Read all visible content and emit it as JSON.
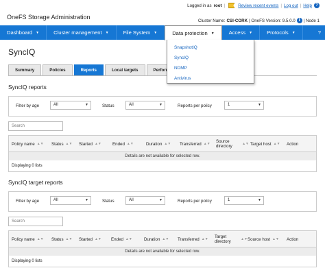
{
  "header": {
    "app_title": "OneFS Storage Administration",
    "logged_in_prefix": "Logged in as",
    "user": "root",
    "review_events": "Review recent events",
    "logout": "Log out",
    "help": "Help",
    "cluster_name_label": "Cluster Name:",
    "cluster_name": "CSI-CORK",
    "version_text": "| OneFS Version: 9.5.0.0",
    "node_text": "| Node 1"
  },
  "nav": {
    "items": [
      {
        "label": "Dashboard"
      },
      {
        "label": "Cluster management"
      },
      {
        "label": "File System"
      },
      {
        "label": "Data protection"
      },
      {
        "label": "Access"
      },
      {
        "label": "Protocols"
      }
    ],
    "help_label": "?"
  },
  "dropdown": {
    "items": [
      "SnapshotIQ",
      "SyncIQ",
      "NDMP",
      "Antivirus"
    ]
  },
  "page": {
    "title": "SyncIQ",
    "tabs": [
      "Summary",
      "Policies",
      "Reports",
      "Local targets",
      "Performance rules"
    ],
    "active_tab": "Reports"
  },
  "reports": {
    "title": "SyncIQ reports",
    "filter_by_age_label": "Filter by age",
    "filter_by_age_value": "All",
    "status_label": "Status",
    "status_value": "All",
    "reports_per_policy_label": "Reports per policy",
    "reports_per_policy_value": "1",
    "search_placeholder": "Search",
    "columns": [
      "Policy name",
      "Status",
      "Started",
      "Ended",
      "Duration",
      "Transferred",
      "Source directory",
      "Target host",
      "Action"
    ],
    "empty_message": "Details are not available for selected row.",
    "footer": "Displaying 0 lists"
  },
  "target_reports": {
    "title": "SyncIQ target reports",
    "filter_by_age_label": "Filter by age",
    "filter_by_age_value": "All",
    "status_label": "Status",
    "status_value": "All",
    "reports_per_policy_label": "Reports per policy",
    "reports_per_policy_value": "1",
    "search_placeholder": "Search",
    "columns": [
      "Policy name",
      "Status",
      "Started",
      "Ended",
      "Duration",
      "Transferred",
      "Target directory",
      "Source host",
      "Action"
    ],
    "empty_message": "Details are not available for selected row.",
    "footer": "Displaying 0 lists"
  },
  "colors": {
    "nav_blue": "#1677d4",
    "link_blue": "#1565c0"
  }
}
